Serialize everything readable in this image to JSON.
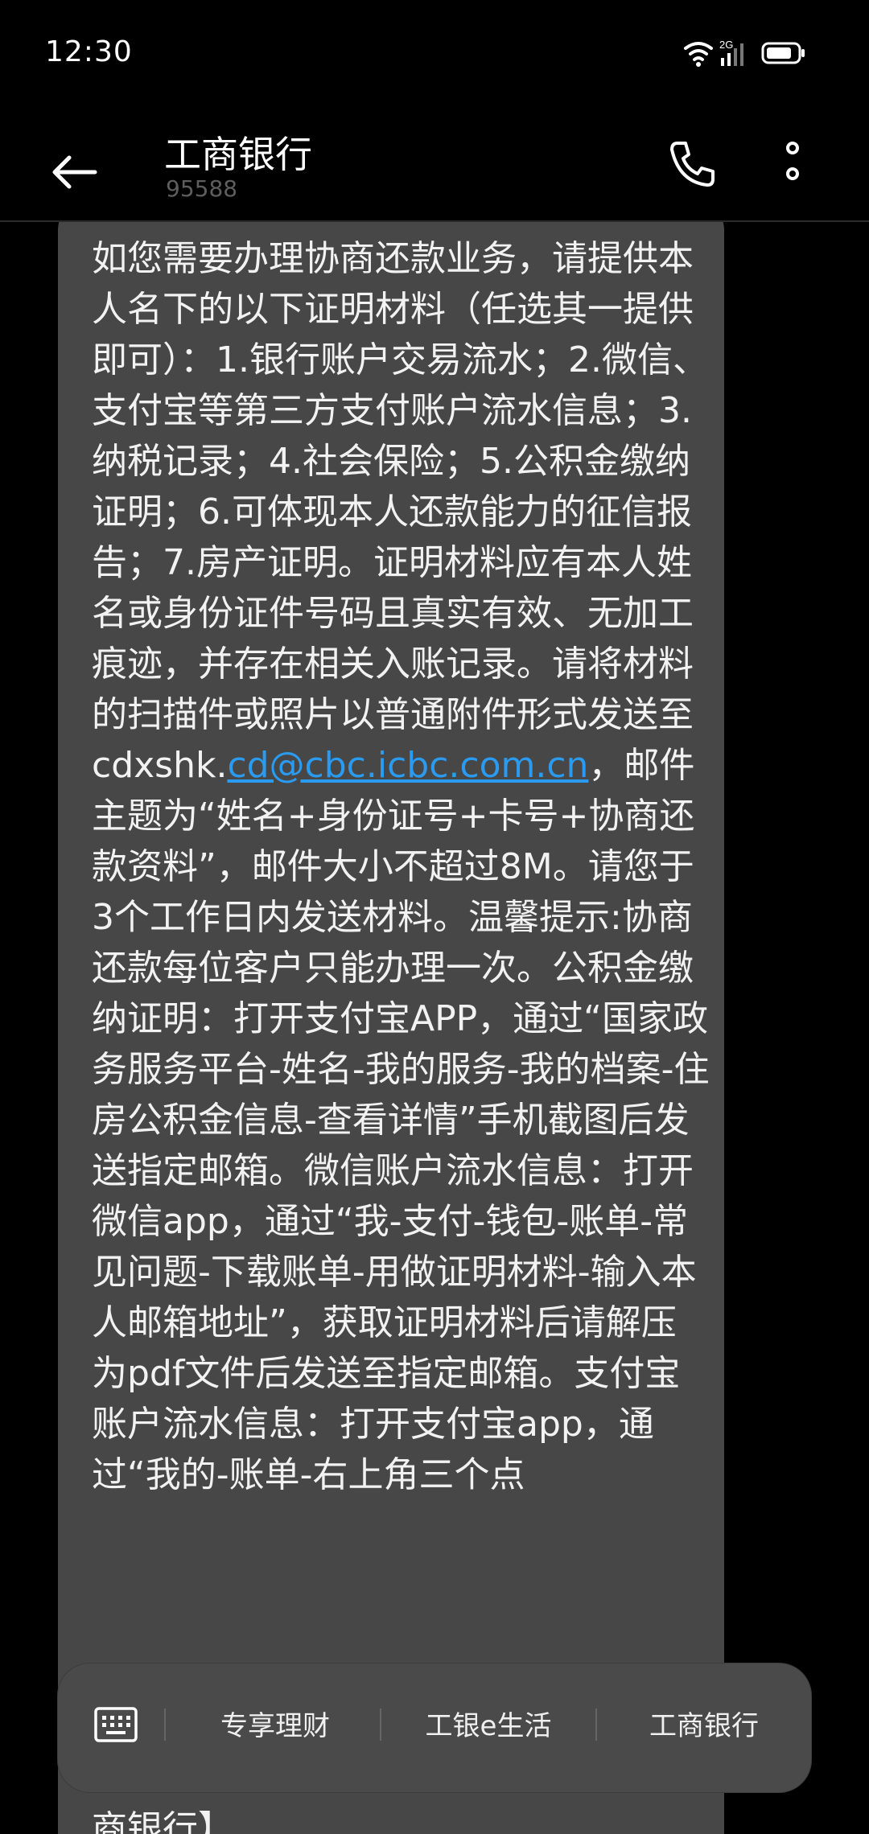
{
  "status": {
    "time": "12:30",
    "network": "2G"
  },
  "header": {
    "title": "工商银行",
    "number": "95588"
  },
  "message": {
    "before_link": "如您需要办理协商还款业务，请提供本人名下的以下证明材料（任选其一提供即可）：1.银行账户交易流水；2.微信、支付宝等第三方支付账户流水信息；3.纳税记录；4.社会保险；5.公积金缴纳证明；6.可体现本人还款能力的征信报告；7.房产证明。证明材料应有本人姓名或身份证件号码且真实有效、无加工痕迹，并存在相关入账记录。请将材料的扫描件或照片以普通附件形式发送至cdxshk.",
    "link": "cd@cbc.icbc.com.cn",
    "after_link": "，邮件主题为“姓名+身份证号+卡号+协商还款资料”，邮件大小不超过8M。请您于3个工作日内发送材料。温馨提示:协商还款每位客户只能办理一次。公积金缴纳证明：打开支付宝APP，通过“国家政务服务平台-姓名-我的服务-我的档案-住房公积金信息-查看详情”手机截图后发送指定邮箱。微信账户流水信息：打开微信app，通过“我-支付-钱包-账单-常见问题-下载账单-用做证明材料-输入本人邮箱地址”，获取证明材料后请解压为pdf文件后发送至指定邮箱。支付宝账户流水信息：打开支付宝app，通过“我的-账单-右上角三个点",
    "tail": "商银行】"
  },
  "quick_menu": {
    "items": [
      "专享理财",
      "工银e生活",
      "工商银行"
    ]
  },
  "colors": {
    "link": "#2a9bf0",
    "bubble": "#474747"
  }
}
